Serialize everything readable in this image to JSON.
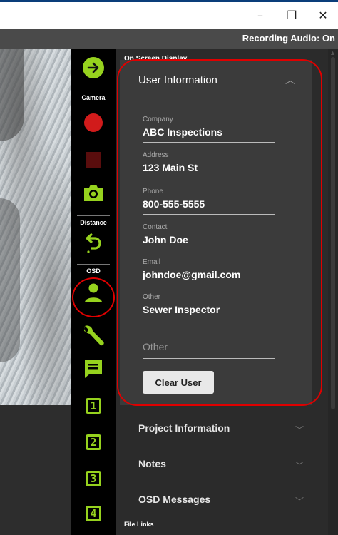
{
  "window": {
    "minimize_glyph": "–",
    "restore_glyph": "❐",
    "close_glyph": "✕"
  },
  "status": {
    "recording_audio": "Recording Audio: On"
  },
  "toolbar": {
    "labels": {
      "camera": "Camera",
      "distance": "Distance",
      "osd": "OSD"
    },
    "icons": [
      "arrow-right-icon",
      "record-icon",
      "stop-icon",
      "camera-icon",
      "undo-icon",
      "user-icon",
      "wrench-icon",
      "message-icon"
    ],
    "presets": [
      "1",
      "2",
      "3",
      "4"
    ],
    "accent_color": "#96d21e"
  },
  "panel": {
    "title": "On Screen Display",
    "user_information": {
      "header": "User Information",
      "fields": [
        {
          "label": "Company",
          "value": "ABC Inspections"
        },
        {
          "label": "Address",
          "value": "123 Main St"
        },
        {
          "label": "Phone",
          "value": "800-555-5555"
        },
        {
          "label": "Contact",
          "value": "John Doe"
        },
        {
          "label": "Email",
          "value": "johndoe@gmail.com"
        },
        {
          "label": "Other",
          "value": "Sewer Inspector"
        }
      ],
      "other_placeholder": "Other",
      "clear_button": "Clear User"
    },
    "sections": [
      "Project Information",
      "Notes",
      "OSD Messages"
    ],
    "footer": "File Links"
  },
  "highlight_color": "#e00000"
}
